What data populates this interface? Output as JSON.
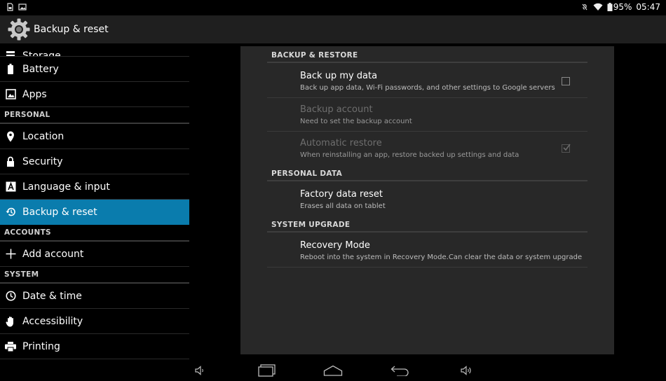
{
  "status_bar": {
    "battery_percent": "95%",
    "time": "05:47",
    "icons": [
      "sd-card-icon",
      "image-notification-icon",
      "mute-icon",
      "wifi-icon",
      "battery-icon"
    ]
  },
  "action_bar": {
    "title": "Backup & reset",
    "icon": "settings-gear-icon"
  },
  "sidebar": {
    "items": [
      {
        "type": "item",
        "label": "Storage",
        "icon": "storage-icon",
        "partial": true
      },
      {
        "type": "item",
        "label": "Battery",
        "icon": "battery-icon"
      },
      {
        "type": "item",
        "label": "Apps",
        "icon": "apps-icon"
      },
      {
        "type": "header",
        "label": "PERSONAL"
      },
      {
        "type": "item",
        "label": "Location",
        "icon": "location-pin-icon"
      },
      {
        "type": "item",
        "label": "Security",
        "icon": "lock-icon"
      },
      {
        "type": "item",
        "label": "Language & input",
        "icon": "keyboard-a-icon"
      },
      {
        "type": "item",
        "label": "Backup & reset",
        "icon": "backup-restore-icon",
        "active": true
      },
      {
        "type": "header",
        "label": "ACCOUNTS"
      },
      {
        "type": "item",
        "label": "Add account",
        "icon": "plus-icon"
      },
      {
        "type": "header",
        "label": "SYSTEM"
      },
      {
        "type": "item",
        "label": "Date & time",
        "icon": "clock-icon"
      },
      {
        "type": "item",
        "label": "Accessibility",
        "icon": "hand-icon"
      },
      {
        "type": "item",
        "label": "Printing",
        "icon": "printer-icon"
      }
    ]
  },
  "content": {
    "sections": [
      {
        "header": "BACKUP & RESTORE",
        "prefs": [
          {
            "title": "Back up my data",
            "summary": "Back up app data, Wi-Fi passwords, and other settings to Google servers",
            "checkbox": true,
            "checked": false,
            "disabled": false
          },
          {
            "title": "Backup account",
            "summary": "Need to set the backup account",
            "checkbox": false,
            "disabled": true
          },
          {
            "title": "Automatic restore",
            "summary": "When reinstalling an app, restore backed up settings and data",
            "checkbox": true,
            "checked": true,
            "disabled": true
          }
        ]
      },
      {
        "header": "PERSONAL DATA",
        "prefs": [
          {
            "title": "Factory data reset",
            "summary": "Erases all data on tablet",
            "checkbox": false,
            "disabled": false
          }
        ]
      },
      {
        "header": "SYSTEM UPGRADE",
        "prefs": [
          {
            "title": "Recovery Mode",
            "summary": "Reboot into the system in Recovery Mode.Can clear the data or system upgrade",
            "checkbox": false,
            "disabled": false
          }
        ]
      }
    ]
  },
  "nav_bar": {
    "buttons": [
      "volume-down-icon",
      "recent-apps-icon",
      "home-icon",
      "back-icon",
      "volume-up-icon"
    ]
  }
}
